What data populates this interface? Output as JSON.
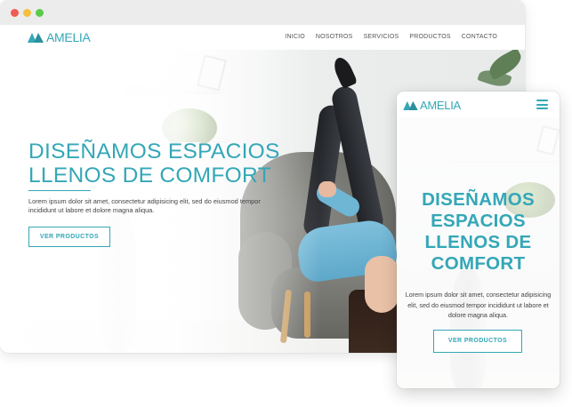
{
  "colors": {
    "accent": "#34a7b7",
    "window_close": "#ee5c54",
    "window_minimize": "#f5bf3f",
    "window_maximize": "#5ccb4a"
  },
  "brand": {
    "name": "AMELIA"
  },
  "nav": {
    "items": [
      {
        "label": "INICIO"
      },
      {
        "label": "NOSOTROS"
      },
      {
        "label": "SERVICIOS"
      },
      {
        "label": "PRODUCTOS"
      },
      {
        "label": "CONTACTO"
      }
    ]
  },
  "hero": {
    "title_line1": "DISEÑAMOS ESPACIOS",
    "title_line2": "LLENOS DE COMFORT",
    "description": "Lorem ipsum dolor sit amet, consectetur adipisicing elit, sed do eiusmod tempor incididunt ut labore et dolore magna aliqua.",
    "button_label": "VER PRODUCTOS"
  },
  "mobile": {
    "menu_icon": "hamburger-menu-icon",
    "title_lines": [
      "DISEÑAMOS",
      "ESPACIOS",
      "LLENOS DE",
      "COMFORT"
    ],
    "description": "Lorem ipsum dolor sit amet, consectetur adipisicing elit, sed do eiusmod tempor incididunt ut labore et dolore magna aliqua.",
    "button_label": "VER PRODUCTOS"
  }
}
